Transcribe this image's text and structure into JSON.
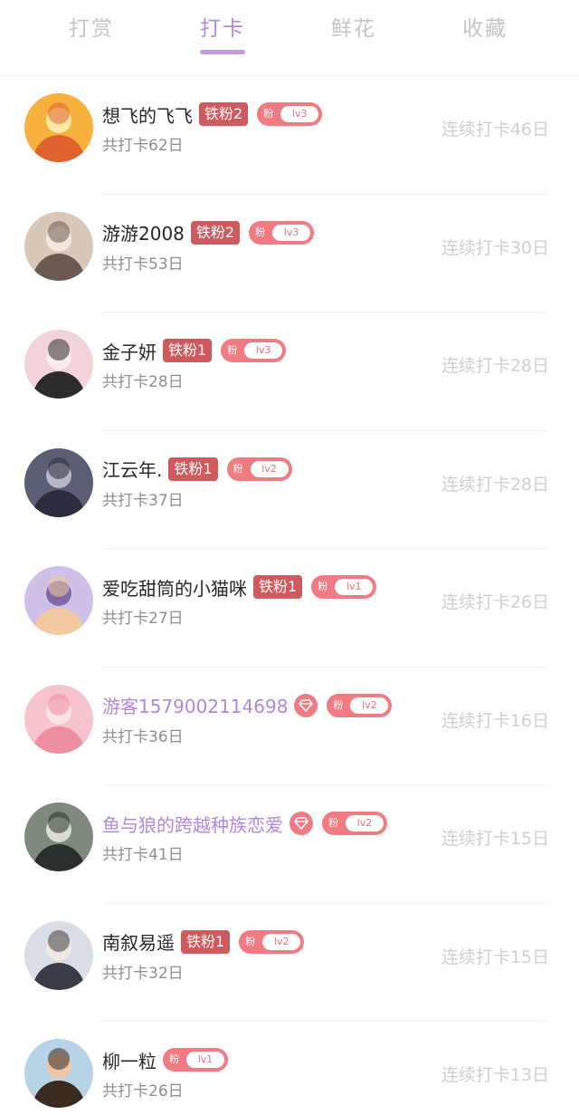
{
  "tabs": [
    {
      "label": "打赏",
      "active": false
    },
    {
      "label": "打卡",
      "active": true
    },
    {
      "label": "鲜花",
      "active": false
    },
    {
      "label": "收藏",
      "active": false
    }
  ],
  "colors": {
    "accent": "#b687e0",
    "badge_iron": "#cf5a5e",
    "fan_badge": "#f07b82",
    "muted_text": "#8e8e8e",
    "streak_text": "#cfcfcf"
  },
  "fan_badge_prefix": "粉",
  "list": [
    {
      "name": "想飞的飞飞",
      "vip": false,
      "iron_badge": "铁粉2",
      "fan_level": "lv3",
      "total": "共打卡62日",
      "streak": "连续打卡46日",
      "avatar_icon": "avatar-image"
    },
    {
      "name": "游游2008",
      "vip": false,
      "iron_badge": "铁粉2",
      "fan_level": "lv3",
      "total": "共打卡53日",
      "streak": "连续打卡30日",
      "avatar_icon": "avatar-image"
    },
    {
      "name": "金子妍",
      "vip": false,
      "iron_badge": "铁粉1",
      "fan_level": "lv3",
      "total": "共打卡28日",
      "streak": "连续打卡28日",
      "avatar_icon": "avatar-image"
    },
    {
      "name": "江云年.",
      "vip": false,
      "iron_badge": "铁粉1",
      "fan_level": "lv2",
      "total": "共打卡37日",
      "streak": "连续打卡28日",
      "avatar_icon": "avatar-image"
    },
    {
      "name": "爱吃甜筒的小猫咪",
      "vip": false,
      "iron_badge": "铁粉1",
      "fan_level": "lv1",
      "total": "共打卡27日",
      "streak": "连续打卡26日",
      "avatar_icon": "avatar-image"
    },
    {
      "name": "游客1579002114698",
      "vip": true,
      "iron_badge": "",
      "fan_level": "lv2",
      "total": "共打卡36日",
      "streak": "连续打卡16日",
      "avatar_icon": "avatar-image"
    },
    {
      "name": "鱼与狼的跨越种族恋爱",
      "vip": true,
      "iron_badge": "",
      "fan_level": "lv2",
      "total": "共打卡41日",
      "streak": "连续打卡15日",
      "avatar_icon": "avatar-image"
    },
    {
      "name": "南叙易遥",
      "vip": false,
      "iron_badge": "铁粉1",
      "fan_level": "lv2",
      "total": "共打卡32日",
      "streak": "连续打卡15日",
      "avatar_icon": "avatar-image"
    },
    {
      "name": "柳一粒",
      "vip": false,
      "iron_badge": "",
      "fan_level": "lv1",
      "total": "共打卡26日",
      "streak": "连续打卡13日",
      "avatar_icon": "avatar-image"
    }
  ]
}
